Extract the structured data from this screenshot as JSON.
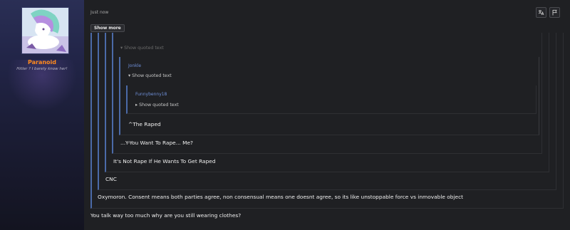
{
  "user": {
    "name": "Paranoid",
    "title": "Hitler ? I barely know her!"
  },
  "post": {
    "timestamp": "Just now",
    "show_more_label": "Show more"
  },
  "quotes": {
    "level5_toggle": "▾ Show quoted text",
    "level3_author": "Jonkle",
    "level3_toggle": "▾ Show quoted text",
    "level2_author": "Funnybenny18",
    "level2_toggle": "▸ Show quoted text",
    "level2_text": "^The Raped",
    "level3_text": "...Y-You Want To Rape... Me?",
    "level4_text": "It's Not Rape If He Wants To Get Raped",
    "level5_text": "CNC",
    "level6_text": "Oxymoron. Consent means both parties agree, non consensual means one doesnt agree, so its like unstoppable force vs inmovable object"
  },
  "reply_text": "You talk way too much why are you still wearing clothes?",
  "icons": {
    "translate": "translate-icon",
    "flag": "flag-icon"
  },
  "colors": {
    "username": "#ff8a1e",
    "quote_border": "#4b6aa8",
    "author_link": "#6f8fd8"
  }
}
